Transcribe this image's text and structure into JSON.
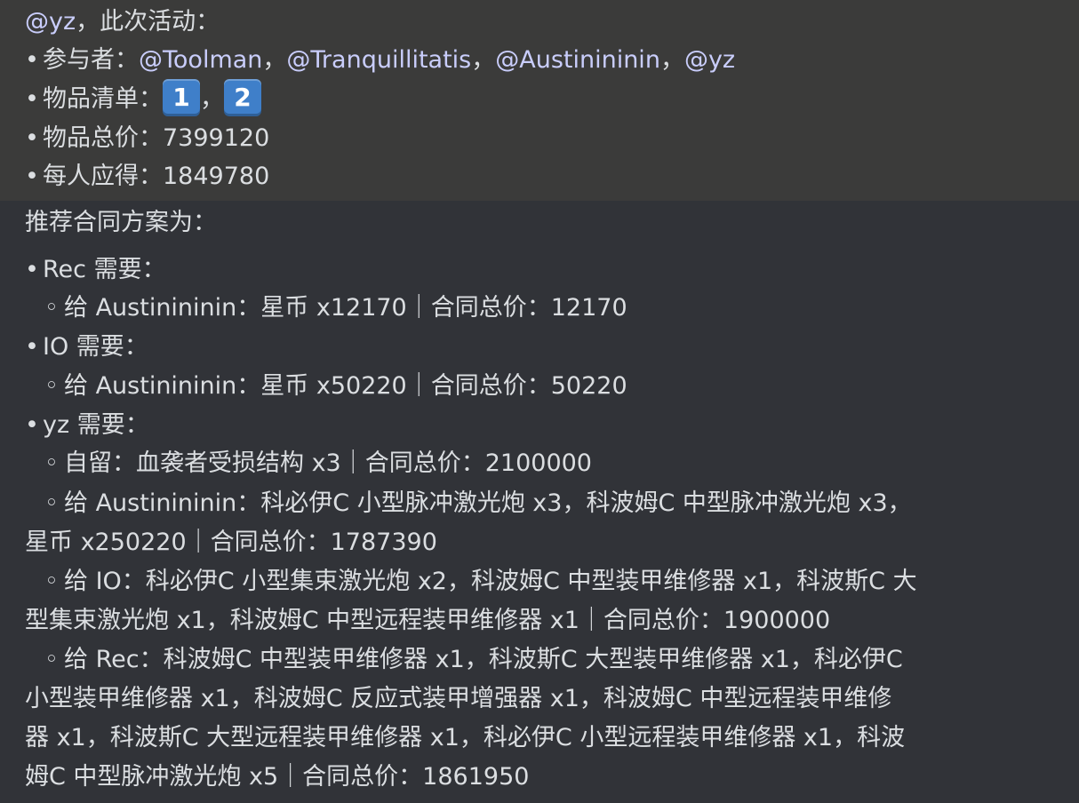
{
  "activity": {
    "author_mention": "@yz",
    "intro": "，此次活动：",
    "participants_label": "参与者：",
    "participants": [
      "@Toolman",
      "@Tranquillitatis",
      "@Austinininin",
      "@yz"
    ],
    "sep": "，",
    "items_label": "物品清单：",
    "item_list": [
      "1",
      "2"
    ],
    "total_label": "物品总价：",
    "total_value": "7399120",
    "share_label": "每人应得：",
    "share_value": "1849780"
  },
  "plan": {
    "title": "推荐合同方案为：",
    "bullet": "•",
    "sub_bullet": "◦",
    "lines": [
      "Rec 需要：",
      "给 Austinininin：星币 x12170｜合同总价：12170",
      "IO 需要：",
      "给 Austinininin：星币 x50220｜合同总价：50220",
      "yz 需要：",
      "自留：血袭者受损结构 x3｜合同总价：2100000",
      "给 Austinininin：科必伊C 小型脉冲激光炮 x3，科波姆C 中型脉冲激光炮 x3，",
      "星币 x250220｜合同总价：1787390",
      "给 IO：科必伊C 小型集束激光炮 x2，科波姆C 中型装甲维修器 x1，科波斯C 大",
      "型集束激光炮 x1，科波姆C 中型远程装甲维修器 x1｜合同总价：1900000",
      "给 Rec：科波姆C 中型装甲维修器 x1，科波斯C 大型装甲维修器 x1，科必伊C",
      "小型装甲维修器 x1，科波姆C 反应式装甲增强器 x1，科波姆C 中型远程装甲维修",
      "器 x1，科波斯C 大型远程装甲维修器 x1，科必伊C 小型远程装甲维修器 x1，科波",
      "姆C 中型脉冲激光炮 x5｜合同总价：1861950"
    ]
  },
  "colors": {
    "background": "#313338",
    "highlight_band": "#3b3b3a",
    "text": "#dbdee1",
    "mention": "#c9cdfb",
    "keycap": "#3f7fc9"
  }
}
